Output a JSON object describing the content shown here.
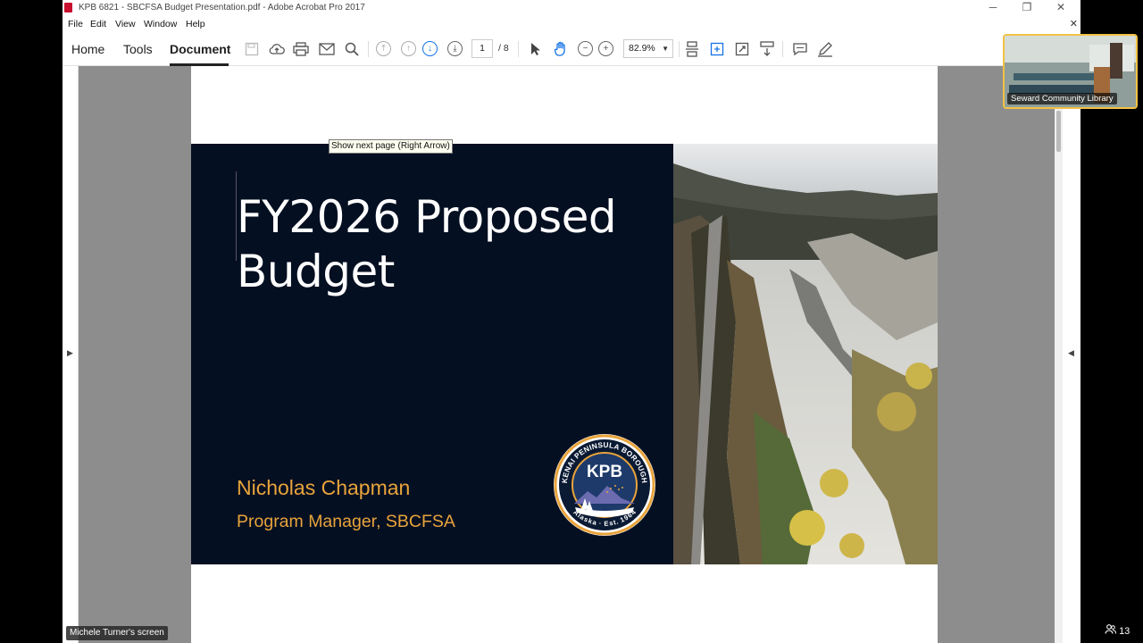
{
  "window": {
    "title": "KPB 6821 - SBCFSA Budget Presentation.pdf - Adobe Acrobat Pro 2017",
    "controls": {
      "minimize": "─",
      "restore": "❐",
      "close": "✕"
    }
  },
  "menu": {
    "items": [
      "File",
      "Edit",
      "View",
      "Window",
      "Help"
    ],
    "close_doc": "✕"
  },
  "toolbar": {
    "tabs": [
      "Home",
      "Tools",
      "Document"
    ],
    "active_tab": "Document",
    "page_current": "1",
    "page_total": "/ 8",
    "zoom": "82.9%",
    "tooltip": "Show next page (Right Arrow)"
  },
  "slide": {
    "title": "FY2026 Proposed Budget",
    "presenter": "Nicholas Chapman",
    "role": "Program Manager, SBCFSA",
    "logo": {
      "top_text": "KENAI PENINSULA BOROUGH",
      "center_text": "KPB",
      "bottom_text": "Alaska · Est. 1964"
    }
  },
  "meeting": {
    "video_label": "Seward Community Library",
    "screen_label": "Michele Turner's screen",
    "participant_count": "13"
  },
  "colors": {
    "slide_bg": "#040f21",
    "accent_gold": "#e9a43c",
    "acrobat_blue": "#1473e6",
    "video_border": "#f3c244"
  }
}
